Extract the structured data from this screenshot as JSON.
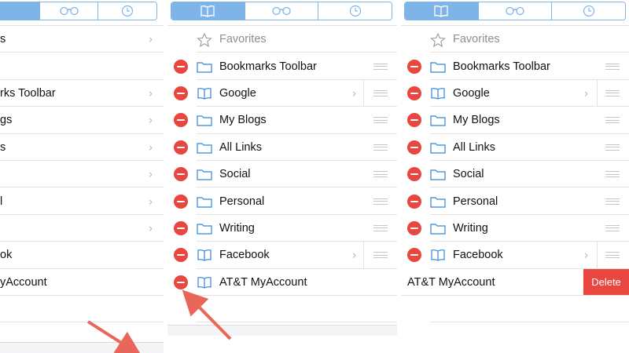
{
  "colors": {
    "accent": "#7fb4e8",
    "delete_red": "#e8463f",
    "arrow": "#e8675a"
  },
  "tabs": [
    {
      "name": "bookmarks",
      "icon": "book-icon"
    },
    {
      "name": "reading-list",
      "icon": "glasses-icon"
    },
    {
      "name": "history",
      "icon": "clock-icon"
    }
  ],
  "left_panel": {
    "rows": [
      {
        "label": "s",
        "chevron": true
      },
      {
        "label": "",
        "chevron": false
      },
      {
        "label": "rks Toolbar",
        "chevron": true
      },
      {
        "label": "gs",
        "chevron": true
      },
      {
        "label": "s",
        "chevron": true
      },
      {
        "label": "",
        "chevron": true
      },
      {
        "label": "l",
        "chevron": true
      },
      {
        "label": "",
        "chevron": true
      },
      {
        "label": "ok",
        "chevron": false
      },
      {
        "label": "yAccount",
        "chevron": false
      }
    ]
  },
  "middle_panel": {
    "favorites": "Favorites",
    "rows": [
      {
        "label": "Bookmarks Toolbar",
        "icon": "folder-icon",
        "chevron": false
      },
      {
        "label": "Google",
        "icon": "book-icon",
        "chevron": true
      },
      {
        "label": "My Blogs",
        "icon": "folder-icon",
        "chevron": false
      },
      {
        "label": "All Links",
        "icon": "folder-icon",
        "chevron": false
      },
      {
        "label": "Social",
        "icon": "folder-icon",
        "chevron": false
      },
      {
        "label": "Personal",
        "icon": "folder-icon",
        "chevron": false
      },
      {
        "label": "Writing",
        "icon": "folder-icon",
        "chevron": false
      },
      {
        "label": "Facebook",
        "icon": "book-icon",
        "chevron": true
      },
      {
        "label": "AT&T MyAccount",
        "icon": "book-icon",
        "chevron": false
      }
    ]
  },
  "right_panel": {
    "favorites": "Favorites",
    "rows": [
      {
        "label": "Bookmarks Toolbar",
        "icon": "folder-icon",
        "chevron": false
      },
      {
        "label": "Google",
        "icon": "book-icon",
        "chevron": true
      },
      {
        "label": "My Blogs",
        "icon": "folder-icon",
        "chevron": false
      },
      {
        "label": "All Links",
        "icon": "folder-icon",
        "chevron": false
      },
      {
        "label": "Social",
        "icon": "folder-icon",
        "chevron": false
      },
      {
        "label": "Personal",
        "icon": "folder-icon",
        "chevron": false
      },
      {
        "label": "Writing",
        "icon": "folder-icon",
        "chevron": false
      },
      {
        "label": "Facebook",
        "icon": "book-icon",
        "chevron": true
      }
    ],
    "swiped_row": {
      "label": "AT&T MyAccount",
      "delete_label": "Delete"
    }
  }
}
